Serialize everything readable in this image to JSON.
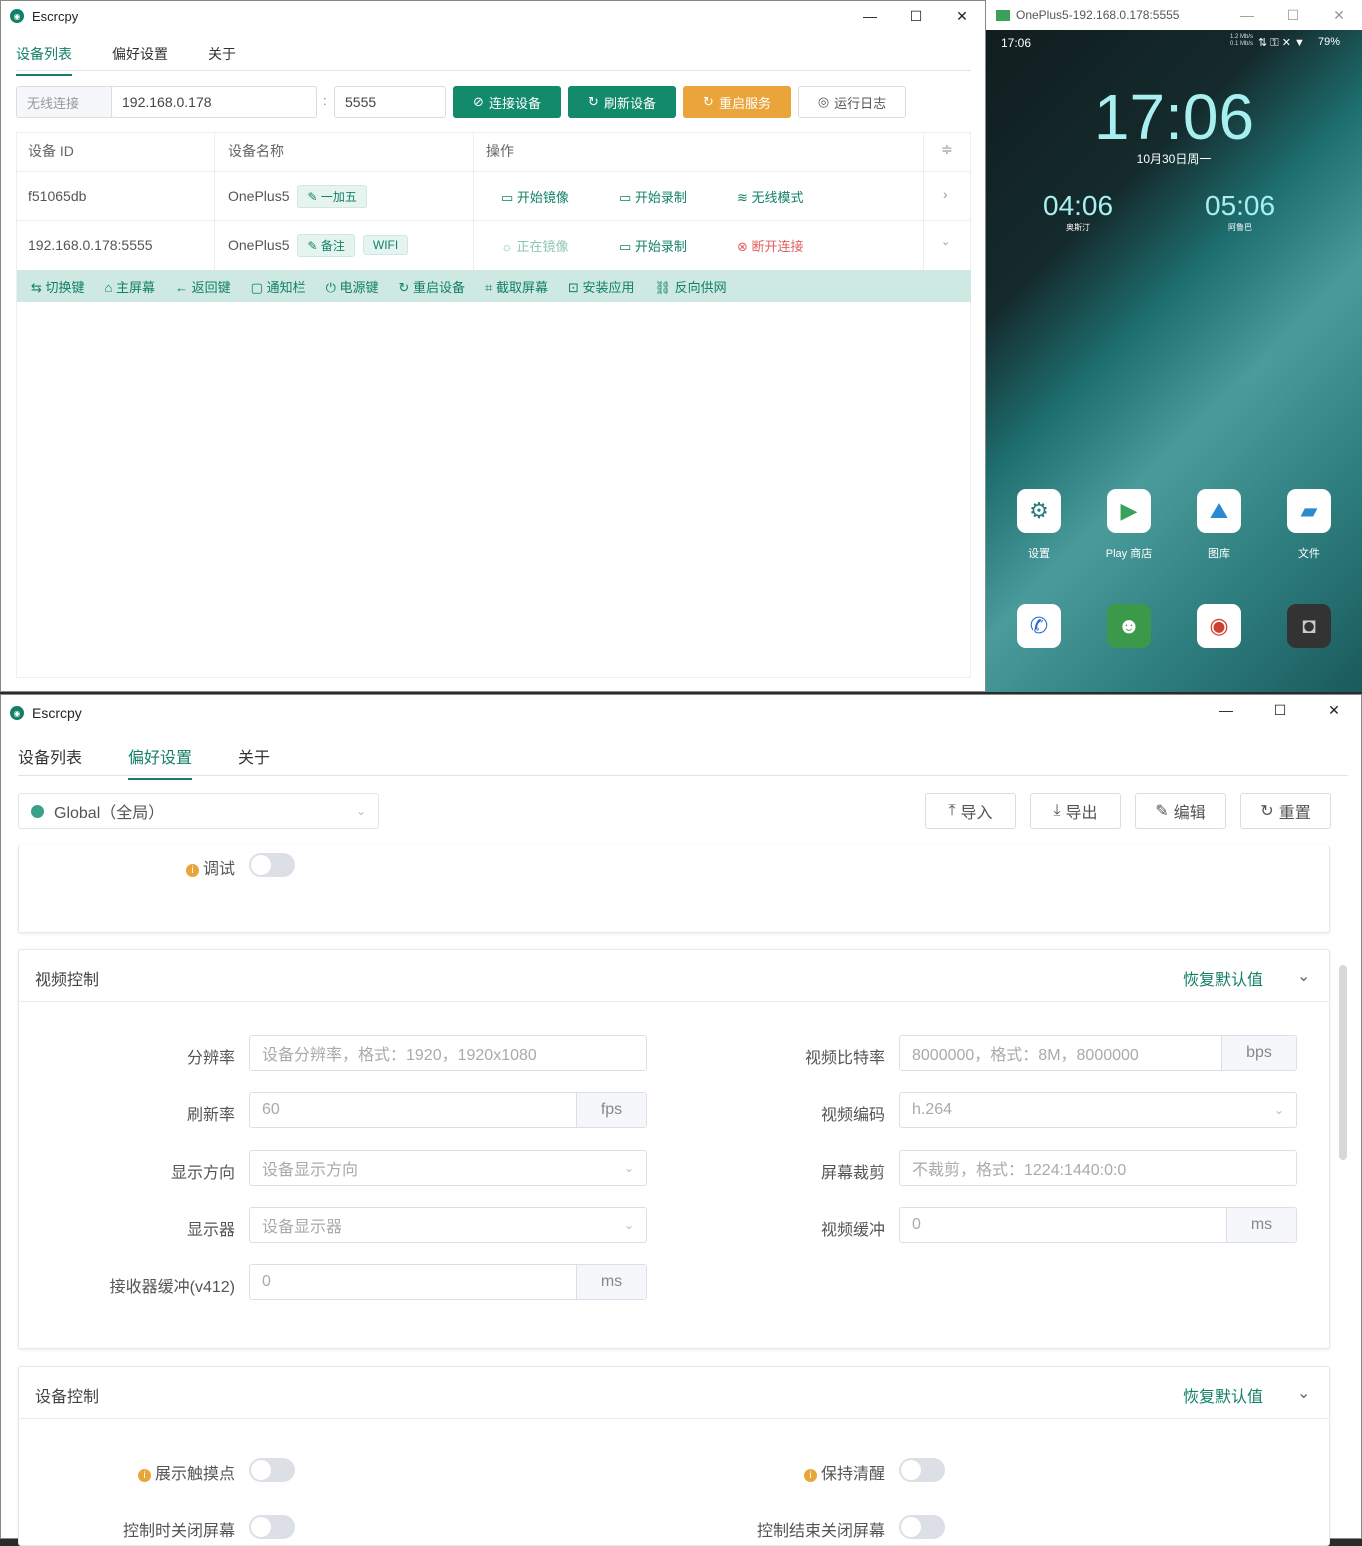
{
  "main_window": {
    "title": "Escrcpy",
    "tabs": [
      "设备列表",
      "偏好设置",
      "关于"
    ],
    "wireless_label": "无线连接",
    "ip_value": "192.168.0.178",
    "port_sep": ":",
    "port_value": "5555",
    "buttons": {
      "connect": "连接设备",
      "refresh": "刷新设备",
      "restart": "重启服务",
      "log": "运行日志"
    },
    "table": {
      "headers": [
        "设备 ID",
        "设备名称",
        "操作"
      ],
      "rows": [
        {
          "id": "f51065db",
          "name": "OnePlus5",
          "tags": [
            "一加五"
          ],
          "actions": [
            "开始镜像",
            "开始录制",
            "无线模式"
          ]
        },
        {
          "id": "192.168.0.178:5555",
          "name": "OnePlus5",
          "tags": [
            "备注",
            "WIFI"
          ],
          "actions": [
            "正在镜像",
            "开始录制",
            "断开连接"
          ]
        }
      ]
    },
    "toolbar": [
      "切换键",
      "主屏幕",
      "返回键",
      "通知栏",
      "电源键",
      "重启设备",
      "截取屏幕",
      "安装应用",
      "反向供网"
    ]
  },
  "phone_window": {
    "title": "OnePlus5-192.168.0.178:5555",
    "status_time": "17:06",
    "net_up": "1.2 Mb/s",
    "net_down": "0.1 Mb/s",
    "battery": "79%",
    "clock": "17:06",
    "date": "10月30日周一",
    "world_clocks": [
      {
        "time": "04:06",
        "city": "奥斯汀"
      },
      {
        "time": "05:06",
        "city": "阿鲁巴"
      }
    ],
    "apps": [
      "设置",
      "Play 商店",
      "图库",
      "文件"
    ]
  },
  "settings_window": {
    "title": "Escrcpy",
    "tabs": [
      "设备列表",
      "偏好设置",
      "关于"
    ],
    "scope": "Global（全局）",
    "buttons": {
      "import": "导入",
      "export": "导出",
      "edit": "编辑",
      "reset": "重置"
    },
    "debug_label": "调试",
    "video": {
      "title": "视频控制",
      "reset": "恢复默认值",
      "resolution": {
        "label": "分辨率",
        "placeholder": "设备分辨率，格式：1920，1920x1080"
      },
      "bitrate": {
        "label": "视频比特率",
        "placeholder": "8000000，格式：8M，8000000",
        "suffix": "bps"
      },
      "fps": {
        "label": "刷新率",
        "value": "60",
        "suffix": "fps"
      },
      "codec": {
        "label": "视频编码",
        "value": "h.264"
      },
      "orientation": {
        "label": "显示方向",
        "placeholder": "设备显示方向"
      },
      "crop": {
        "label": "屏幕裁剪",
        "placeholder": "不裁剪，格式：1224:1440:0:0"
      },
      "display": {
        "label": "显示器",
        "placeholder": "设备显示器"
      },
      "buffer": {
        "label": "视频缓冲",
        "value": "0",
        "suffix": "ms"
      },
      "rx_buffer": {
        "label": "接收器缓冲(v412)",
        "value": "0",
        "suffix": "ms"
      }
    },
    "device": {
      "title": "设备控制",
      "reset": "恢复默认值",
      "show_touches": "展示触摸点",
      "stay_awake": "保持清醒",
      "turn_off_on_control": "控制时关闭屏幕",
      "turn_off_on_close": "控制结束关闭屏幕"
    }
  }
}
